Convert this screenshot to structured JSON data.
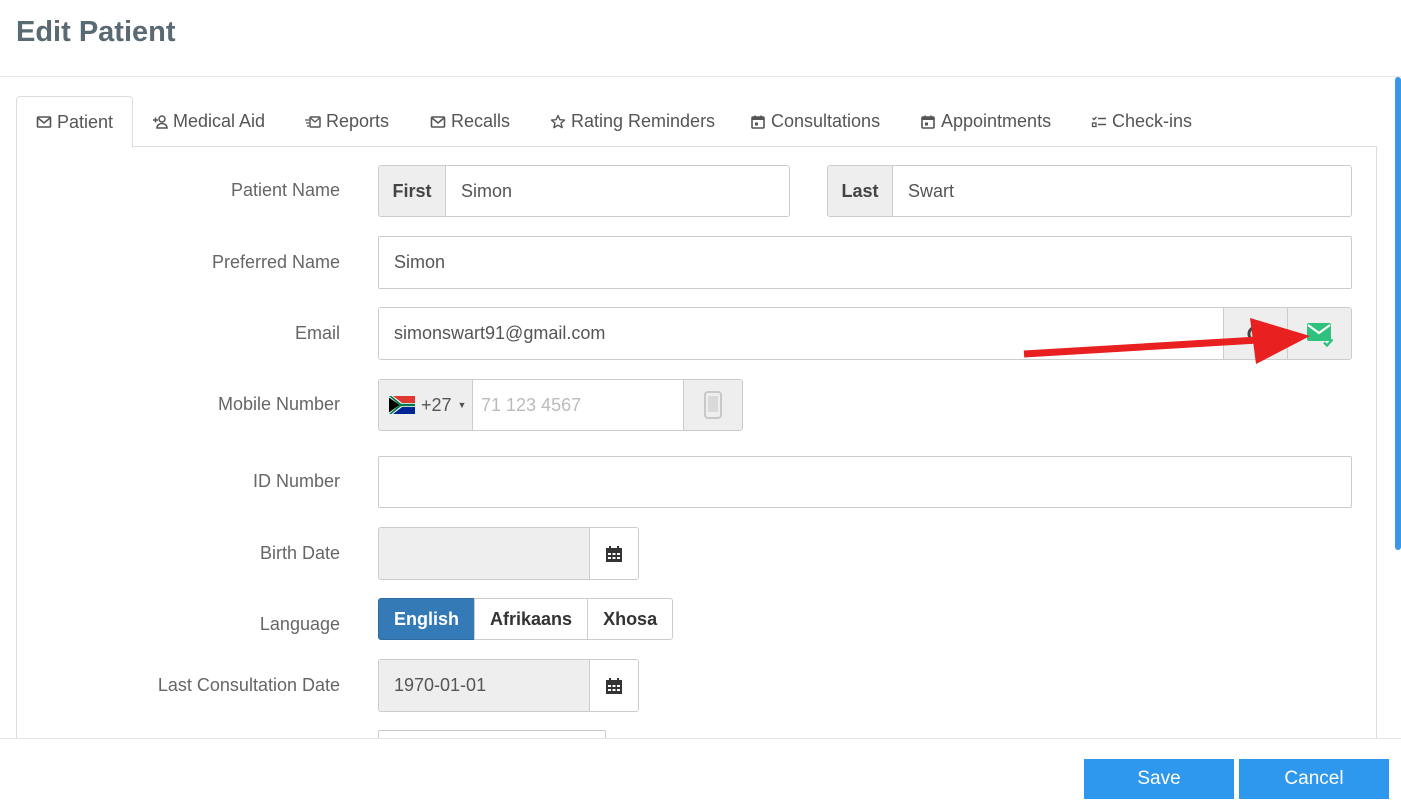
{
  "modal": {
    "title": "Edit Patient"
  },
  "tabs": [
    {
      "label": "Patient",
      "icon": "envelope-icon",
      "active": true
    },
    {
      "label": "Medical Aid",
      "icon": "add-user-icon"
    },
    {
      "label": "Reports",
      "icon": "email-send-icon"
    },
    {
      "label": "Recalls",
      "icon": "envelope-icon"
    },
    {
      "label": "Rating Reminders",
      "icon": "star-outline-icon"
    },
    {
      "label": "Consultations",
      "icon": "calendar-icon"
    },
    {
      "label": "Appointments",
      "icon": "calendar-icon"
    },
    {
      "label": "Check-ins",
      "icon": "checklist-icon"
    }
  ],
  "form": {
    "patient_name": {
      "label": "Patient Name",
      "first_addon": "First",
      "first_value": "Simon",
      "last_addon": "Last",
      "last_value": "Swart"
    },
    "preferred_name": {
      "label": "Preferred Name",
      "value": "Simon"
    },
    "email": {
      "label": "Email",
      "value": "simonswart91@gmail.com",
      "verified_color": "#2ec27e"
    },
    "mobile": {
      "label": "Mobile Number",
      "country_code": "+27",
      "placeholder": "71 123 4567"
    },
    "id_number": {
      "label": "ID Number",
      "value": ""
    },
    "birth_date": {
      "label": "Birth Date",
      "value": ""
    },
    "language": {
      "label": "Language",
      "options": [
        "English",
        "Afrikaans",
        "Xhosa"
      ],
      "selected": "English"
    },
    "last_consultation": {
      "label": "Last Consultation Date",
      "value": "1970-01-01"
    }
  },
  "footer": {
    "save_label": "Save",
    "cancel_label": "Cancel"
  },
  "colors": {
    "primary": "#2e97ee",
    "active_lang": "#337ab7",
    "annotation": "#e8201f"
  }
}
